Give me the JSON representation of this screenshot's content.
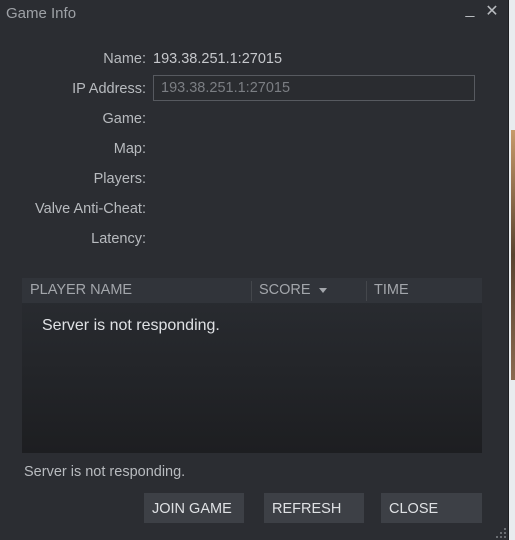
{
  "window": {
    "title": "Game Info",
    "minimize_glyph": "_",
    "close_glyph": "✕"
  },
  "fields": [
    {
      "label": "Name:",
      "value": "193.38.251.1:27015"
    },
    {
      "label": "IP Address:"
    },
    {
      "label": "Game:",
      "value": ""
    },
    {
      "label": "Map:",
      "value": ""
    },
    {
      "label": "Players:",
      "value": ""
    },
    {
      "label": "Valve Anti-Cheat:",
      "value": ""
    },
    {
      "label": "Latency:",
      "value": ""
    }
  ],
  "ip_input": {
    "value": "193.38.251.1:27015"
  },
  "table": {
    "columns": [
      "PLAYER NAME",
      "SCORE",
      "TIME"
    ],
    "sorted_by": "SCORE",
    "message": "Server is not responding."
  },
  "status": "Server is not responding.",
  "buttons": {
    "join": "JOIN GAME",
    "refresh": "REFRESH",
    "close": "CLOSE"
  },
  "colors": {
    "window_bg": "#2b2d32",
    "button_bg": "#3d4046",
    "text": "#c6c8cc"
  }
}
